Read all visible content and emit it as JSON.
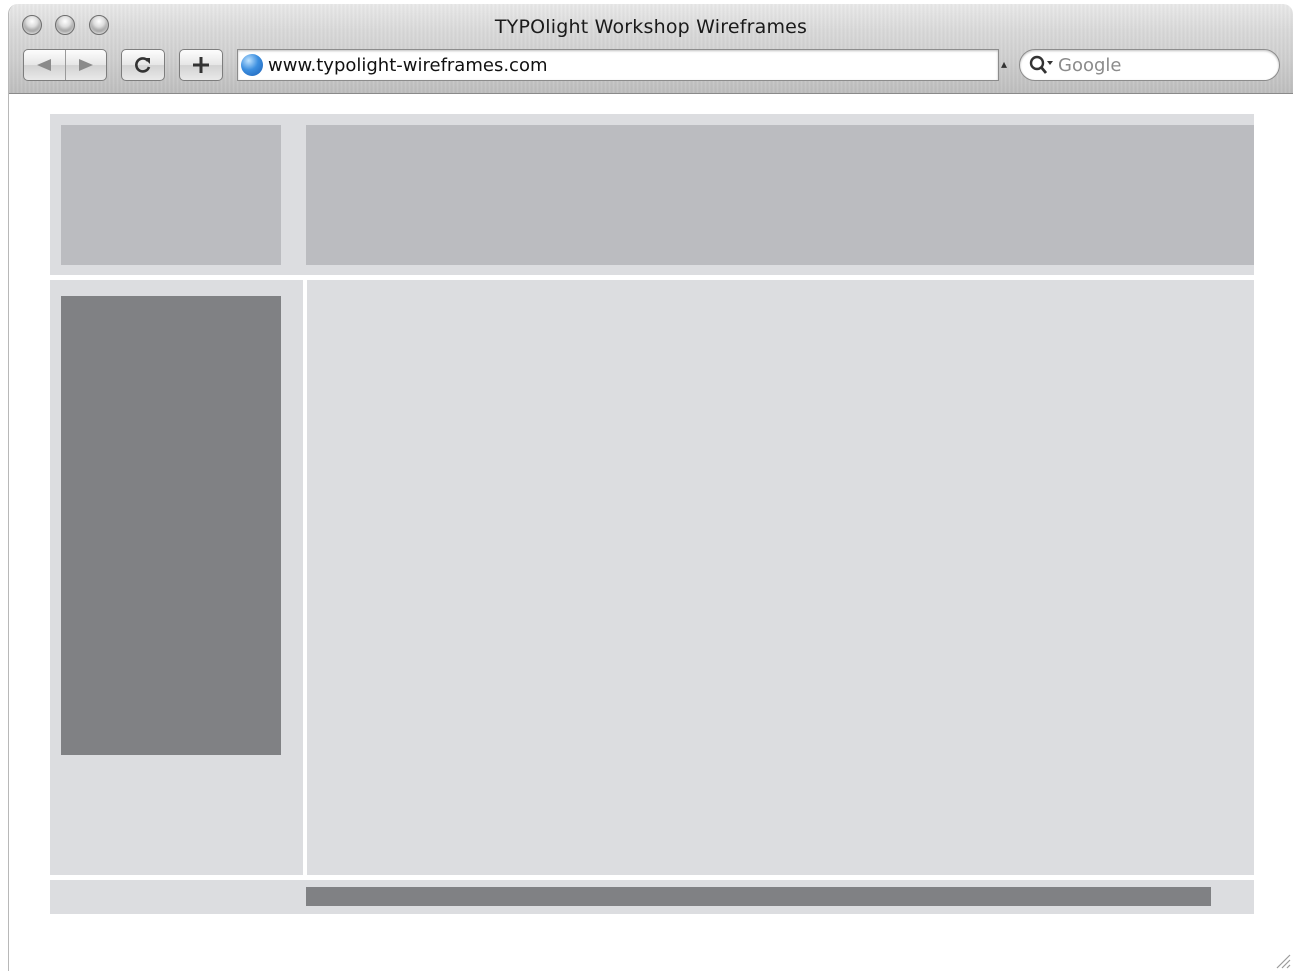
{
  "window": {
    "title": "TYPOlight Workshop Wireframes"
  },
  "toolbar": {
    "back_icon": "back-arrow-icon",
    "forward_icon": "forward-arrow-icon",
    "reload_icon": "reload-icon",
    "add_bookmark_icon": "plus-icon"
  },
  "address_bar": {
    "url": "www.typolight-wireframes.com",
    "site_icon": "globe-icon"
  },
  "search": {
    "placeholder": "Google",
    "icon": "search-icon"
  },
  "colors": {
    "light_gray_block": "#dcdde0",
    "medium_gray_block": "#bbbcc0",
    "dark_gray_block": "#808184"
  }
}
